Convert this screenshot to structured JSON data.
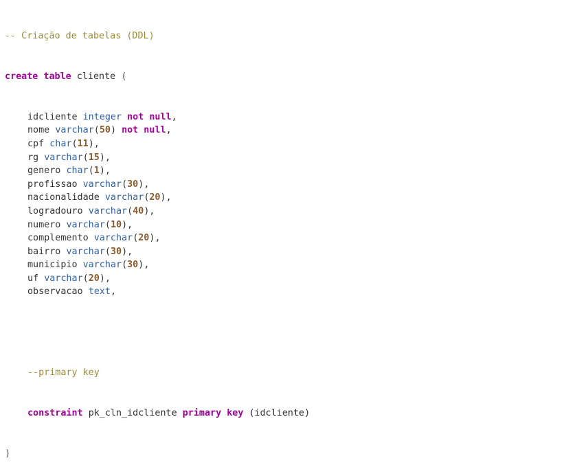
{
  "code": {
    "comment_ddl": "-- Criação de tabelas (DDL)",
    "kw_create": "create",
    "kw_table": "table",
    "table_name": "cliente",
    "open_paren": "(",
    "columns": [
      {
        "name": "idcliente",
        "type": "integer",
        "size": "",
        "constraint": "not null"
      },
      {
        "name": "nome",
        "type": "varchar",
        "size": "50",
        "constraint": "not null"
      },
      {
        "name": "cpf",
        "type": "char",
        "size": "11",
        "constraint": ""
      },
      {
        "name": "rg",
        "type": "varchar",
        "size": "15",
        "constraint": ""
      },
      {
        "name": "genero",
        "type": "char",
        "size": "1",
        "constraint": ""
      },
      {
        "name": "profissao",
        "type": "varchar",
        "size": "30",
        "constraint": ""
      },
      {
        "name": "nacionalidade",
        "type": "varchar",
        "size": "20",
        "constraint": ""
      },
      {
        "name": "logradouro",
        "type": "varchar",
        "size": "40",
        "constraint": ""
      },
      {
        "name": "numero",
        "type": "varchar",
        "size": "10",
        "constraint": ""
      },
      {
        "name": "complemento",
        "type": "varchar",
        "size": "20",
        "constraint": ""
      },
      {
        "name": "bairro",
        "type": "varchar",
        "size": "30",
        "constraint": ""
      },
      {
        "name": "municipio",
        "type": "varchar",
        "size": "30",
        "constraint": ""
      },
      {
        "name": "uf",
        "type": "varchar",
        "size": "20",
        "constraint": ""
      },
      {
        "name": "observacao",
        "type": "text",
        "size": "",
        "constraint": ""
      }
    ],
    "comment_pk": "--primary key",
    "kw_constraint": "constraint",
    "pk_name": "pk_cln_idcliente",
    "kw_primary_key": "primary key",
    "pk_columns": "(idcliente)",
    "close_paren": ")"
  },
  "colors": {
    "background": "#ffffff",
    "comment": "#998a33",
    "keyword": "#a3009e",
    "type": "#2d5fa8",
    "number": "#8a5a2b",
    "identifier": "#333333"
  }
}
